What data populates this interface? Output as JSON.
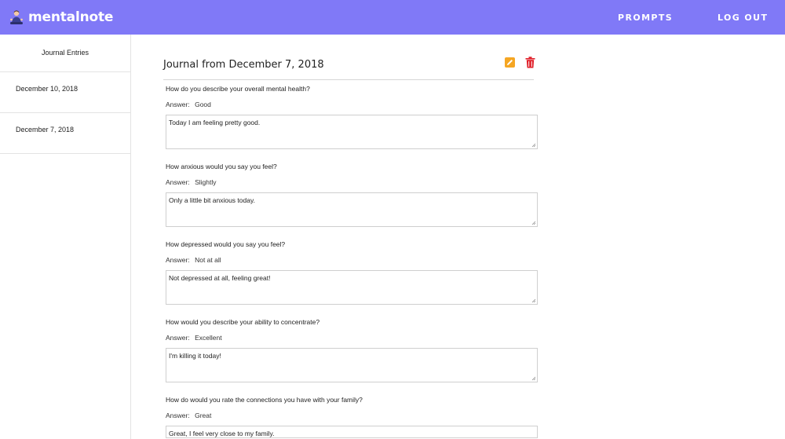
{
  "app": {
    "name": "mentalnote"
  },
  "nav": {
    "prompts": "PROMPTS",
    "logout": "LOG OUT"
  },
  "sidebar": {
    "header": "Journal Entries",
    "items": [
      {
        "label": "December 10, 2018"
      },
      {
        "label": "December 7, 2018"
      }
    ]
  },
  "journal": {
    "title": "Journal from December 7, 2018",
    "answer_label": "Answer:",
    "entries": [
      {
        "question": "How do you describe your overall mental health?",
        "answer": "Good",
        "response": "Today I am feeling pretty good."
      },
      {
        "question": "How anxious would you say you feel?",
        "answer": "Slightly",
        "response": "Only a little bit anxious today."
      },
      {
        "question": "How depressed would you say you feel?",
        "answer": "Not at all",
        "response": "Not depressed at all, feeling great!"
      },
      {
        "question": "How would you describe your ability to concentrate?",
        "answer": "Excellent",
        "response": "I'm killing it today!"
      },
      {
        "question": "How do would you rate the connections you have with your family?",
        "answer": "Great",
        "response": "Great, I feel very close to my family."
      }
    ]
  },
  "colors": {
    "header": "#8079f7",
    "edit": "#f5a623",
    "delete": "#e0202a"
  },
  "icons": {
    "brand": "person-meditation-icon",
    "edit": "pencil-icon",
    "delete": "trash-icon"
  }
}
